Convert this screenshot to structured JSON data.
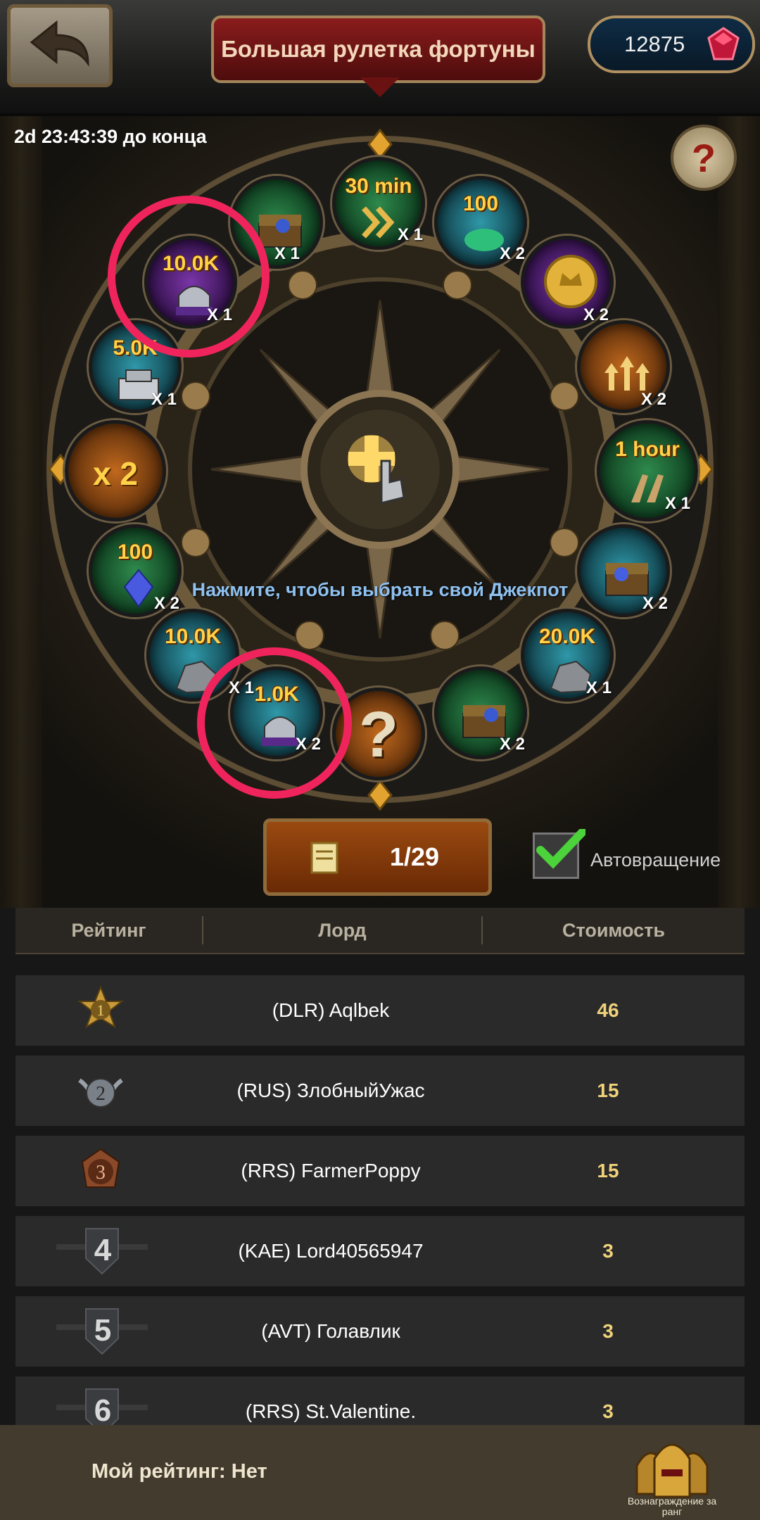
{
  "header": {
    "title": "Большая рулетка фортуны",
    "gems": "12875"
  },
  "wheel": {
    "timer": "2d 23:43:39 до конца",
    "help": "?",
    "jackpot_hint": "Нажмите, чтобы выбрать свой Джекпот",
    "multiplier": "x 2",
    "mystery": "?",
    "slots": {
      "chest_top": {
        "qty": "X 1"
      },
      "speedup_30": {
        "val": "30 min",
        "qty": "X 1"
      },
      "green_100": {
        "val": "100",
        "qty": "X 2"
      },
      "gold_coin": {
        "qty": "X 2"
      },
      "upgrade": {
        "qty": "X 2"
      },
      "speed_1h": {
        "val": "1 hour",
        "qty": "X 1"
      },
      "chest_right": {
        "qty": "X 2"
      },
      "iron_20k": {
        "val": "20.0K",
        "qty": "X 1"
      },
      "chest_bottom": {
        "qty": "X 2"
      },
      "exp_1k": {
        "val": "1.0K",
        "qty": "X 2"
      },
      "iron_10k": {
        "val": "10.0K",
        "qty": "X 1"
      },
      "crystal_100": {
        "val": "100",
        "qty": "X 2"
      },
      "silver_5k": {
        "val": "5.0K",
        "qty": "X 1"
      },
      "exp_10k": {
        "val": "10.0K",
        "qty": "X 1"
      }
    }
  },
  "spin": {
    "count": "1/29",
    "autospin_label": "Автовращение"
  },
  "board": {
    "headers": [
      "Рейтинг",
      "Лорд",
      "Стоимость"
    ],
    "rows": [
      {
        "rank": "1",
        "lord": "(DLR) Aqlbek",
        "cost": "46"
      },
      {
        "rank": "2",
        "lord": "(RUS) ЗлобныйУжас",
        "cost": "15"
      },
      {
        "rank": "3",
        "lord": "(RRS) FarmerPoppy",
        "cost": "15"
      },
      {
        "rank": "4",
        "lord": "(KAE) Lord40565947",
        "cost": "3"
      },
      {
        "rank": "5",
        "lord": "(AVT) Голавлик",
        "cost": "3"
      },
      {
        "rank": "6",
        "lord": "(RRS) St.Valentine.",
        "cost": "3"
      }
    ]
  },
  "footer": {
    "my_rank": "Мой рейтинг: Нет",
    "reward_label": "Вознаграждение за ранг"
  },
  "colors": {
    "highlight_ring": "#f0245c",
    "accent_gold": "#ffd24a",
    "title_red": "#8a1c1c"
  }
}
